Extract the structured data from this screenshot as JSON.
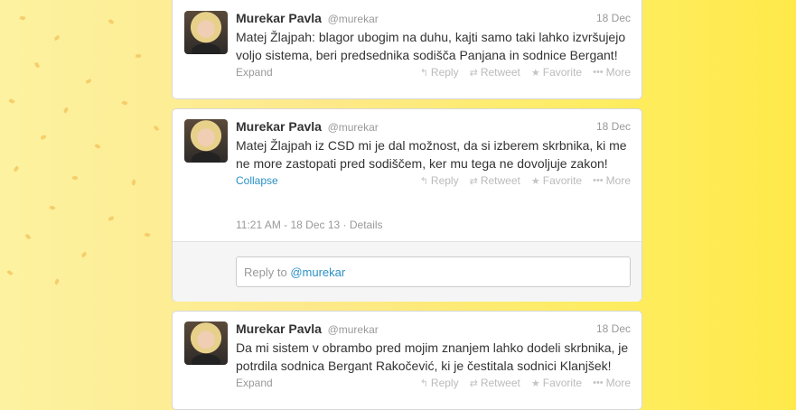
{
  "actions": {
    "reply": "Reply",
    "retweet": "Retweet",
    "favorite": "Favorite",
    "more": "More"
  },
  "tweets": [
    {
      "name": "Murekar Pavla",
      "handle": "@murekar",
      "date": "18 Dec",
      "text": "Matej Žlajpah: blagor ubogim na duhu, kajti samo taki lahko izvršujejo voljo sistema, beri predsednika sodišča Panjana in sodnice Bergant!",
      "toggle": "Expand"
    },
    {
      "name": "Murekar Pavla",
      "handle": "@murekar",
      "date": "18 Dec",
      "text": "Matej Žlajpah iz CSD mi je dal možnost, da si izberem skrbnika, ki me ne more zastopati pred sodiščem, ker mu tega ne dovoljuje zakon!",
      "toggle": "Collapse",
      "timestamp": "11:21 AM - 18 Dec 13",
      "details": "Details",
      "reply_prefix": "Reply to ",
      "reply_mention": "@murekar"
    },
    {
      "name": "Murekar Pavla",
      "handle": "@murekar",
      "date": "18 Dec",
      "text": "Da mi sistem v obrambo pred mojim znanjem lahko dodeli skrbnika, je potrdila sodnica Bergant Rakočević, ki je čestitala sodnici Klanjšek!",
      "toggle": "Expand"
    }
  ],
  "colors": {
    "link": "#2a91c6",
    "muted": "#999999",
    "background_yellow": "#feed62"
  }
}
